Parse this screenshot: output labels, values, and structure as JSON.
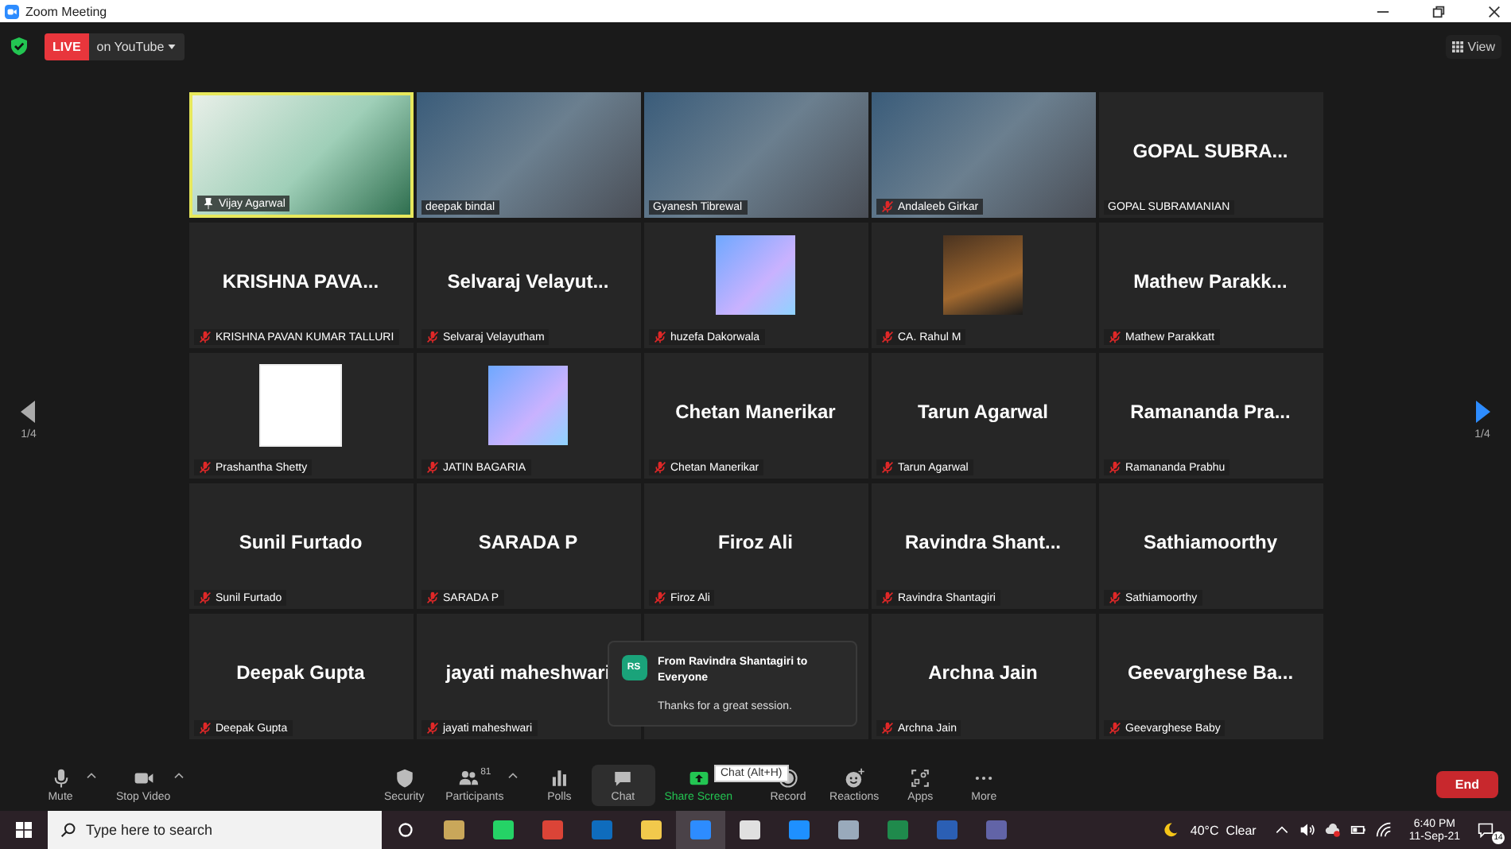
{
  "window": {
    "title": "Zoom Meeting"
  },
  "live": {
    "badge": "LIVE",
    "destination": "on YouTube"
  },
  "view_button": "View",
  "pager": {
    "left": "1/4",
    "right": "1/4"
  },
  "tiles": [
    {
      "kind": "video",
      "label": "Vijay Agarwal",
      "muted": false,
      "pinned": true,
      "speaking": true
    },
    {
      "kind": "video",
      "label": "deepak bindal",
      "muted": false,
      "pinned": false,
      "speaking": false
    },
    {
      "kind": "video",
      "label": "Gyanesh Tibrewal",
      "muted": false,
      "pinned": false,
      "speaking": false
    },
    {
      "kind": "video",
      "label": "Andaleeb Girkar",
      "muted": true,
      "pinned": false,
      "speaking": false
    },
    {
      "kind": "name",
      "display_name": "GOPAL SUBRA...",
      "label": "GOPAL SUBRAMANIAN",
      "muted": false,
      "pinned": false,
      "speaking": false
    },
    {
      "kind": "name",
      "display_name": "KRISHNA PAVA...",
      "label": "KRISHNA PAVAN KUMAR TALLURI",
      "muted": true,
      "pinned": false,
      "speaking": false
    },
    {
      "kind": "name",
      "display_name": "Selvaraj Velayut...",
      "label": "Selvaraj Velayutham",
      "muted": true,
      "pinned": false,
      "speaking": false
    },
    {
      "kind": "image",
      "label": "huzefa Dakorwala",
      "muted": true,
      "pinned": false,
      "speaking": false
    },
    {
      "kind": "image",
      "label": "CA. Rahul M",
      "muted": true,
      "pinned": false,
      "speaking": false
    },
    {
      "kind": "name",
      "display_name": "Mathew Parakk...",
      "label": "Mathew Parakkatt",
      "muted": true,
      "pinned": false,
      "speaking": false
    },
    {
      "kind": "image",
      "label": "Prashantha Shetty",
      "muted": true,
      "pinned": false,
      "speaking": false
    },
    {
      "kind": "image",
      "label": "JATIN BAGARIA",
      "muted": true,
      "pinned": false,
      "speaking": false
    },
    {
      "kind": "name",
      "display_name": "Chetan Manerikar",
      "label": "Chetan Manerikar",
      "muted": true,
      "pinned": false,
      "speaking": false
    },
    {
      "kind": "name",
      "display_name": "Tarun Agarwal",
      "label": "Tarun Agarwal",
      "muted": true,
      "pinned": false,
      "speaking": false
    },
    {
      "kind": "name",
      "display_name": "Ramananda Pra...",
      "label": "Ramananda Prabhu",
      "muted": true,
      "pinned": false,
      "speaking": false
    },
    {
      "kind": "name",
      "display_name": "Sunil Furtado",
      "label": "Sunil Furtado",
      "muted": true,
      "pinned": false,
      "speaking": false
    },
    {
      "kind": "name",
      "display_name": "SARADA P",
      "label": "SARADA P",
      "muted": true,
      "pinned": false,
      "speaking": false
    },
    {
      "kind": "name",
      "display_name": "Firoz Ali",
      "label": "Firoz Ali",
      "muted": true,
      "pinned": false,
      "speaking": false
    },
    {
      "kind": "name",
      "display_name": "Ravindra Shant...",
      "label": "Ravindra Shantagiri",
      "muted": true,
      "pinned": false,
      "speaking": false
    },
    {
      "kind": "name",
      "display_name": "Sathiamoorthy",
      "label": "Sathiamoorthy",
      "muted": true,
      "pinned": false,
      "speaking": false
    },
    {
      "kind": "name",
      "display_name": "Deepak Gupta",
      "label": "Deepak Gupta",
      "muted": true,
      "pinned": false,
      "speaking": false
    },
    {
      "kind": "name",
      "display_name": "jayati maheshwari",
      "label": "jayati maheshwari",
      "muted": true,
      "pinned": false,
      "speaking": false
    },
    {
      "kind": "covered",
      "speaking": false
    },
    {
      "kind": "name",
      "display_name": "Archna Jain",
      "label": "Archna Jain",
      "muted": true,
      "pinned": false,
      "speaking": false
    },
    {
      "kind": "name",
      "display_name": "Geevarghese Ba...",
      "label": "Geevarghese Baby",
      "muted": true,
      "pinned": false,
      "speaking": false
    }
  ],
  "chat_popup": {
    "initials": "RS",
    "title": "From Ravindra Shantagiri to Everyone",
    "message": "Thanks for a great session."
  },
  "tooltip": "Chat (Alt+H)",
  "toolbar": {
    "items": [
      {
        "label": "Mute",
        "selected": false
      },
      {
        "label": "Stop Video",
        "selected": false
      },
      {
        "label": "Security",
        "selected": false
      },
      {
        "label": "Participants",
        "count": "81",
        "selected": false
      },
      {
        "label": "Polls",
        "selected": false
      },
      {
        "label": "Chat",
        "selected": true
      },
      {
        "label": "Share Screen",
        "selected": false
      },
      {
        "label": "Record",
        "selected": false
      },
      {
        "label": "Reactions",
        "selected": false
      },
      {
        "label": "Apps",
        "selected": false
      },
      {
        "label": "More",
        "selected": false
      }
    ],
    "end_button": "End"
  },
  "taskbar": {
    "search_placeholder": "Type here to search",
    "apps": [
      {
        "selected": false
      },
      {
        "selected": false
      },
      {
        "selected": false
      },
      {
        "selected": false
      },
      {
        "selected": false
      },
      {
        "selected": true
      },
      {
        "selected": false
      },
      {
        "selected": false
      },
      {
        "selected": false
      },
      {
        "selected": false
      },
      {
        "selected": false
      },
      {
        "selected": false
      }
    ],
    "weather": "40°C  Clear",
    "time": "6:40 PM",
    "date": "11-Sep-21",
    "notifications": "14"
  }
}
